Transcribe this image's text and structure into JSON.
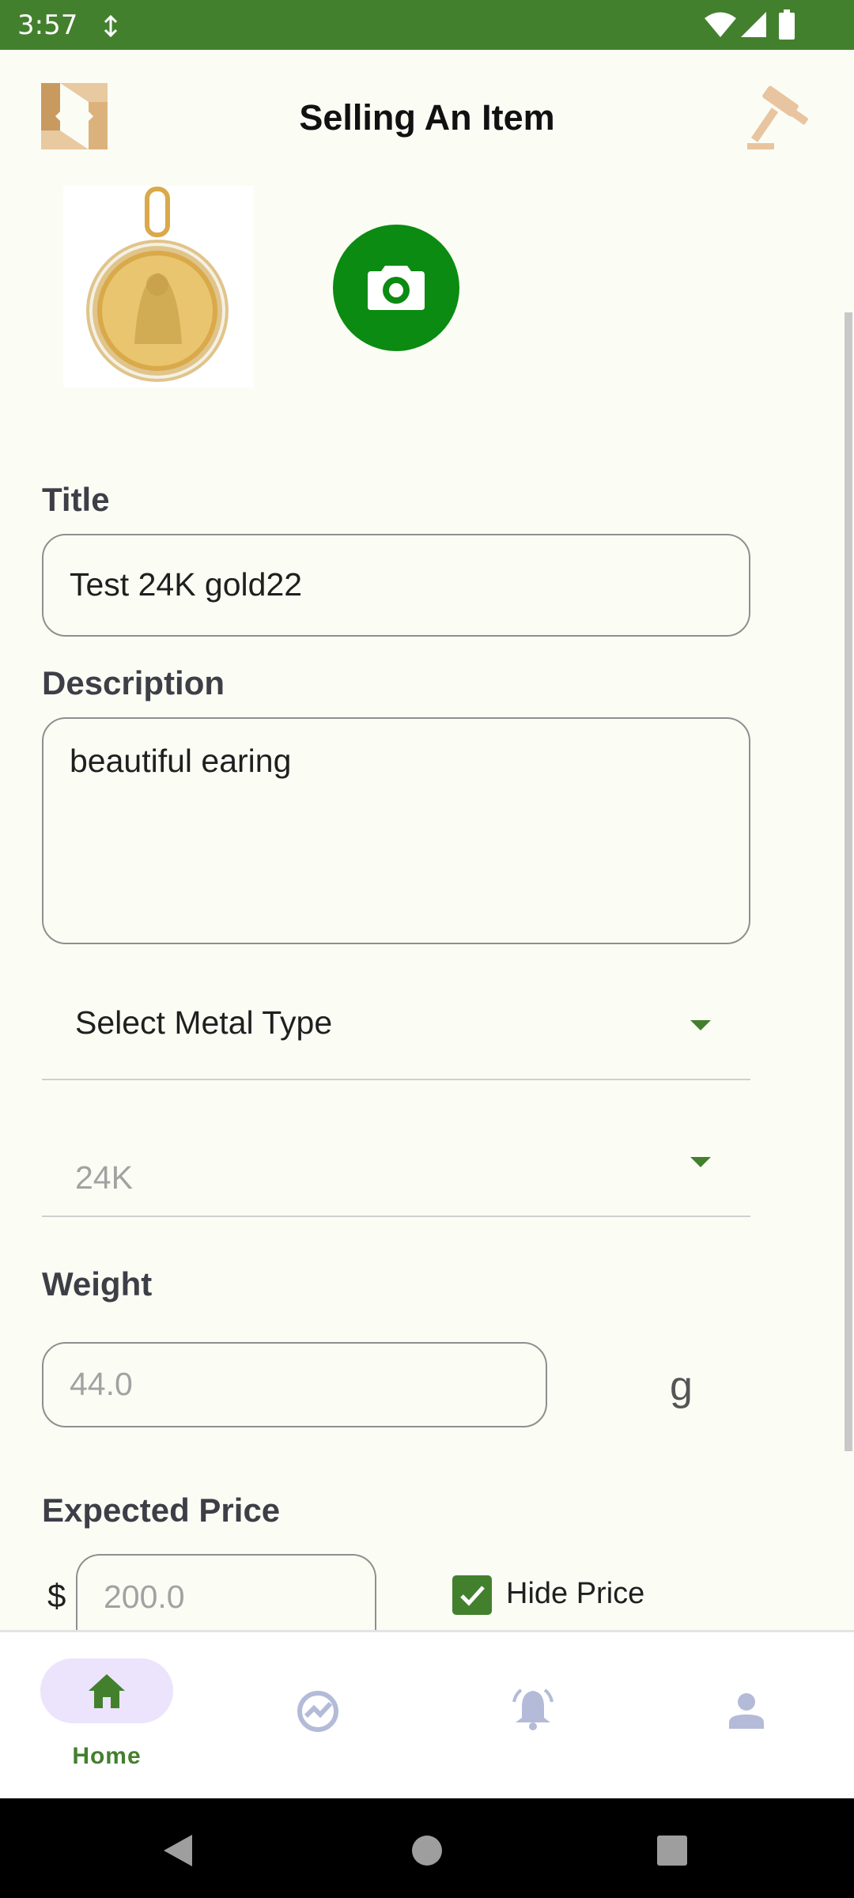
{
  "status_bar": {
    "time": "3:57",
    "icons": [
      "data-saver-icon",
      "wifi-icon",
      "signal-icon",
      "battery-icon"
    ]
  },
  "header": {
    "title": "Selling An Item",
    "logo_icon": "app-logo-icon",
    "action_icon": "gavel-icon"
  },
  "form": {
    "title_label": "Title",
    "title_value": "Test 24K gold22",
    "description_label": "Description",
    "description_value": "beautiful earing",
    "metal_type_value": "Select Metal Type",
    "karat_value": "24K",
    "weight_label": "Weight",
    "weight_placeholder": "44.0",
    "weight_unit": "g",
    "price_label": "Expected Price",
    "currency_symbol": "$",
    "price_placeholder": "200.0",
    "hide_price_label": "Hide Price",
    "hide_price_checked": true
  },
  "bottom_nav": {
    "items": [
      {
        "label": "Home",
        "icon": "home-icon",
        "active": true
      },
      {
        "label": "",
        "icon": "trending-icon",
        "active": false
      },
      {
        "label": "",
        "icon": "bell-icon",
        "active": false
      },
      {
        "label": "",
        "icon": "person-icon",
        "active": false
      }
    ]
  },
  "colors": {
    "brand_green": "#43802e",
    "camera_green": "#0b8b11",
    "background": "#fbfdf5",
    "nav_pill": "#ece3fc",
    "nav_inactive": "#b4bbd8",
    "logo_gold": "#dcb27c"
  }
}
